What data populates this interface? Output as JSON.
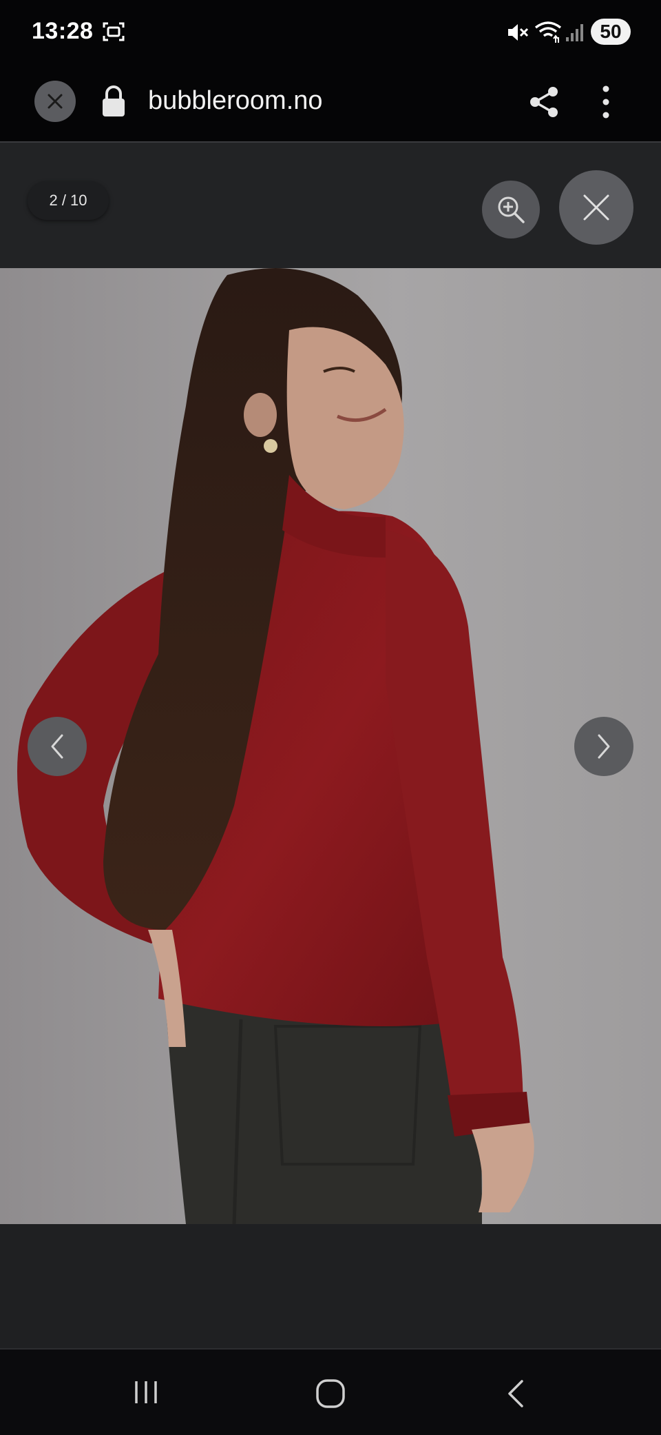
{
  "status_bar": {
    "time": "13:28",
    "battery": "50",
    "icons": [
      "screenshot-icon",
      "mute-icon",
      "wifi-icon",
      "signal-icon"
    ]
  },
  "browser": {
    "url": "bubbleroom.no",
    "icons": [
      "close-icon",
      "lock-icon",
      "share-icon",
      "more-vert-icon"
    ]
  },
  "gallery": {
    "counter": "2 / 10",
    "icons": [
      "zoom-in-icon",
      "close-icon",
      "chevron-left-icon",
      "chevron-right-icon"
    ]
  },
  "photo": {
    "subject": "product-photo",
    "background_color": "#a3a0a1",
    "top_color": "#8d1a1f",
    "pants_color": "#2d2d2a"
  },
  "nav_bar": {
    "icons": [
      "recents-icon",
      "home-icon",
      "back-icon"
    ]
  }
}
